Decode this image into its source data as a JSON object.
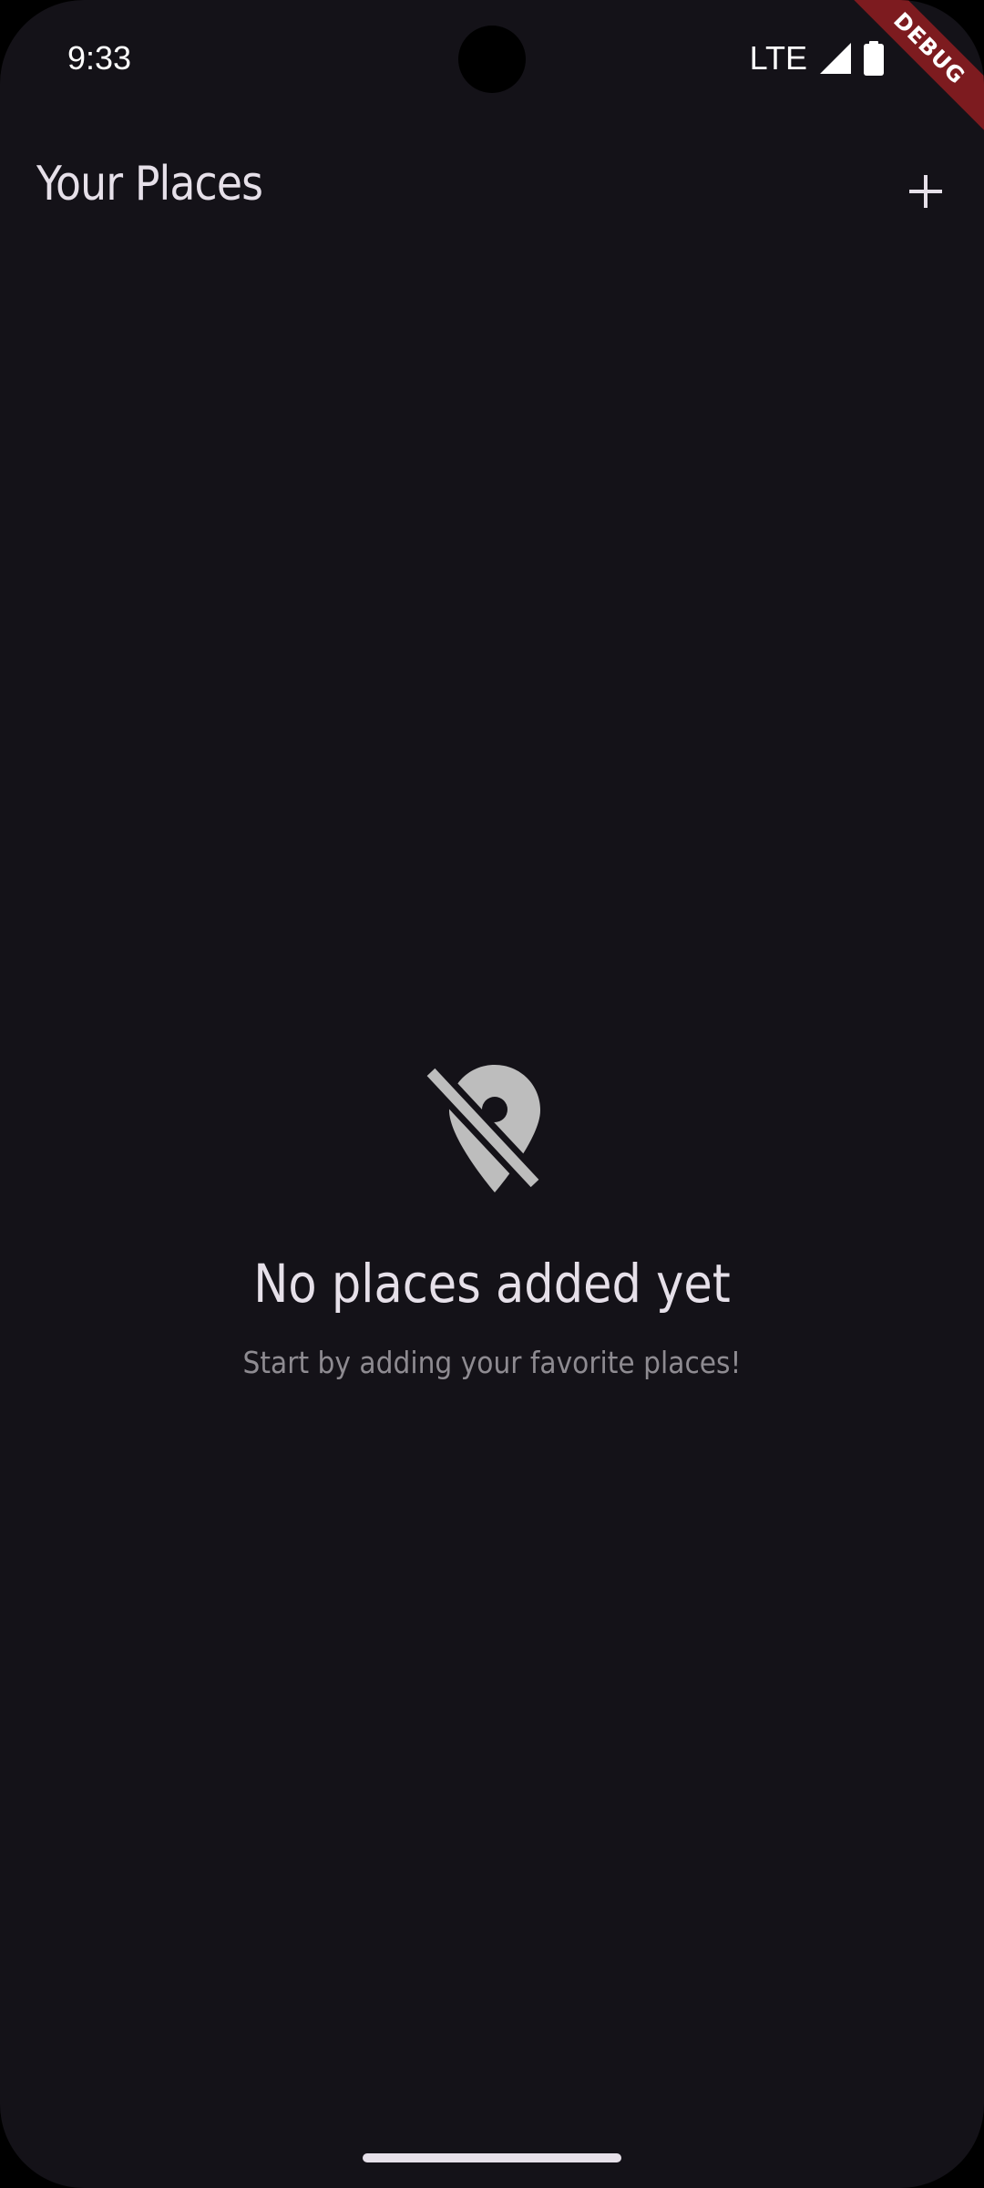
{
  "status_bar": {
    "time": "9:33",
    "network": "LTE",
    "signal_icon": "signal-full-icon",
    "battery_icon": "battery-full-icon"
  },
  "debug_banner": {
    "label": "DEBUG",
    "color": "#7d1b1f"
  },
  "app_bar": {
    "title": "Your Places",
    "add_icon": "plus-icon"
  },
  "empty_state": {
    "icon": "location-off-icon",
    "title": "No places added yet",
    "subtitle": "Start by adding your favorite places!"
  },
  "theme": {
    "background": "#141218",
    "on_surface": "#e6e0e9",
    "icon_color": "#bdbdbd",
    "muted_text": "#8e8b91"
  }
}
